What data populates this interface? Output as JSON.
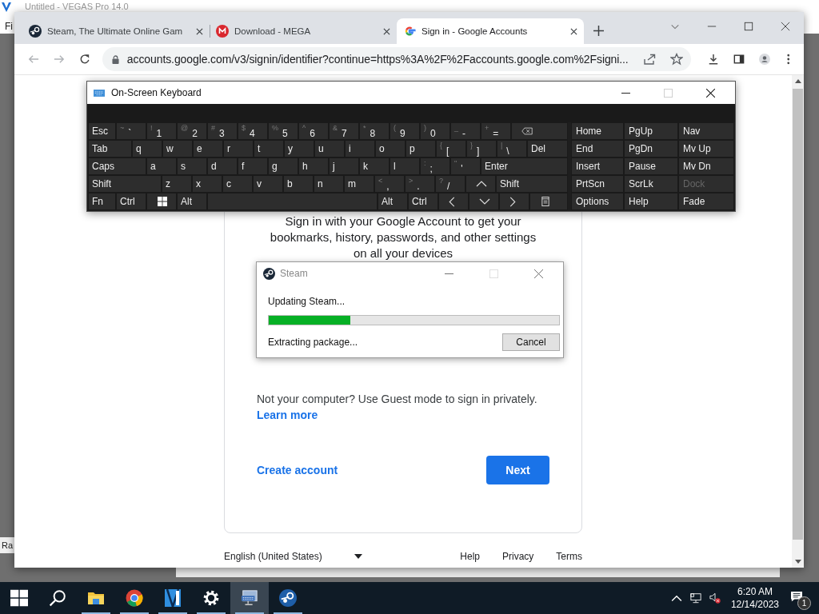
{
  "background_window": {
    "title": "Untitled - VEGAS Pro 14.0",
    "menu_fragment": "Fi",
    "side_fragment": "Ra"
  },
  "browser": {
    "tabs": [
      {
        "title": "Steam, The Ultimate Online Gam",
        "kind": "steam",
        "selected": false
      },
      {
        "title": "Download - MEGA",
        "kind": "mega",
        "selected": false
      },
      {
        "title": "Sign in - Google Accounts",
        "kind": "google",
        "selected": true
      }
    ],
    "url": "accounts.google.com/v3/signin/identifier?continue=https%3A%2F%2Faccounts.google.com%2Fsigni..."
  },
  "page": {
    "intro": "Sign in with your Google Account to get your bookmarks, history, passwords, and other settings on all your devices",
    "guest_note": "Not your computer? Use Guest mode to sign in privately.",
    "learn_more": "Learn more",
    "create_account": "Create account",
    "next": "Next",
    "language": "English (United States)",
    "footer_links": [
      "Help",
      "Privacy",
      "Terms"
    ]
  },
  "keyboard": {
    "title": "On-Screen Keyboard",
    "rows": [
      {
        "keys": [
          {
            "kind": "label",
            "label": "Esc"
          },
          {
            "kind": "dual",
            "shift": "~",
            "main": "`"
          },
          {
            "kind": "dual",
            "shift": "!",
            "main": "1"
          },
          {
            "kind": "dual",
            "shift": "@",
            "main": "2"
          },
          {
            "kind": "dual",
            "shift": "#",
            "main": "3"
          },
          {
            "kind": "dual",
            "shift": "$",
            "main": "4"
          },
          {
            "kind": "dual",
            "shift": "%",
            "main": "5"
          },
          {
            "kind": "dual",
            "shift": "^",
            "main": "6"
          },
          {
            "kind": "dual",
            "shift": "&",
            "main": "7"
          },
          {
            "kind": "dual",
            "shift": "*",
            "main": "8"
          },
          {
            "kind": "dual",
            "shift": "(",
            "main": "9"
          },
          {
            "kind": "dual",
            "shift": ")",
            "main": "0"
          },
          {
            "kind": "dual",
            "shift": "_",
            "main": "-"
          },
          {
            "kind": "dual",
            "shift": "+",
            "main": "="
          },
          {
            "kind": "backspace"
          }
        ]
      },
      {
        "keys": [
          {
            "kind": "label",
            "label": "Tab"
          },
          {
            "kind": "label",
            "label": "q"
          },
          {
            "kind": "label",
            "label": "w"
          },
          {
            "kind": "label",
            "label": "e"
          },
          {
            "kind": "label",
            "label": "r"
          },
          {
            "kind": "label",
            "label": "t"
          },
          {
            "kind": "label",
            "label": "y"
          },
          {
            "kind": "label",
            "label": "u"
          },
          {
            "kind": "label",
            "label": "i"
          },
          {
            "kind": "label",
            "label": "o"
          },
          {
            "kind": "label",
            "label": "p"
          },
          {
            "kind": "dual",
            "shift": "{",
            "main": "["
          },
          {
            "kind": "dual",
            "shift": "}",
            "main": "]"
          },
          {
            "kind": "dual",
            "shift": "|",
            "main": "\\"
          },
          {
            "kind": "label",
            "label": "Del"
          }
        ]
      },
      {
        "keys": [
          {
            "kind": "label",
            "label": "Caps"
          },
          {
            "kind": "label",
            "label": "a"
          },
          {
            "kind": "label",
            "label": "s"
          },
          {
            "kind": "label",
            "label": "d"
          },
          {
            "kind": "label",
            "label": "f"
          },
          {
            "kind": "label",
            "label": "g"
          },
          {
            "kind": "label",
            "label": "h"
          },
          {
            "kind": "label",
            "label": "j"
          },
          {
            "kind": "label",
            "label": "k"
          },
          {
            "kind": "label",
            "label": "l"
          },
          {
            "kind": "dual",
            "shift": ":",
            "main": ";"
          },
          {
            "kind": "dual",
            "shift": "\"",
            "main": "'"
          },
          {
            "kind": "label",
            "label": "Enter"
          }
        ]
      },
      {
        "keys": [
          {
            "kind": "label",
            "label": "Shift"
          },
          {
            "kind": "label",
            "label": "z"
          },
          {
            "kind": "label",
            "label": "x"
          },
          {
            "kind": "label",
            "label": "c"
          },
          {
            "kind": "label",
            "label": "v"
          },
          {
            "kind": "label",
            "label": "b"
          },
          {
            "kind": "label",
            "label": "n"
          },
          {
            "kind": "label",
            "label": "m"
          },
          {
            "kind": "dual",
            "shift": "<",
            "main": ","
          },
          {
            "kind": "dual",
            "shift": ">",
            "main": "."
          },
          {
            "kind": "dual",
            "shift": "?",
            "main": "/"
          },
          {
            "kind": "up"
          },
          {
            "kind": "label",
            "label": "Shift"
          }
        ]
      },
      {
        "keys": [
          {
            "kind": "label",
            "label": "Fn"
          },
          {
            "kind": "label",
            "label": "Ctrl"
          },
          {
            "kind": "windows"
          },
          {
            "kind": "label",
            "label": "Alt"
          },
          {
            "kind": "space"
          },
          {
            "kind": "label",
            "label": "Alt"
          },
          {
            "kind": "label",
            "label": "Ctrl"
          },
          {
            "kind": "left"
          },
          {
            "kind": "down"
          },
          {
            "kind": "right"
          },
          {
            "kind": "menu"
          }
        ]
      }
    ],
    "nav_rows": [
      [
        {
          "label": "Home",
          "disabled": false
        },
        {
          "label": "PgUp",
          "disabled": false
        },
        {
          "label": "Nav",
          "disabled": false
        }
      ],
      [
        {
          "label": "End",
          "disabled": false
        },
        {
          "label": "PgDn",
          "disabled": false
        },
        {
          "label": "Mv Up",
          "disabled": false
        }
      ],
      [
        {
          "label": "Insert",
          "disabled": false
        },
        {
          "label": "Pause",
          "disabled": false
        },
        {
          "label": "Mv Dn",
          "disabled": false
        }
      ],
      [
        {
          "label": "PrtScn",
          "disabled": false
        },
        {
          "label": "ScrLk",
          "disabled": false
        },
        {
          "label": "Dock",
          "disabled": true
        }
      ],
      [
        {
          "label": "Options",
          "disabled": false
        },
        {
          "label": "Help",
          "disabled": false
        },
        {
          "label": "Fade",
          "disabled": false
        }
      ]
    ]
  },
  "steam_dialog": {
    "title": "Steam",
    "status": "Updating Steam...",
    "progress": {
      "level": 0.28
    },
    "detail": "Extracting package...",
    "cancel": "Cancel"
  },
  "taskbar": {
    "apps": [
      {
        "kind": "explorer",
        "running": true,
        "selected": false
      },
      {
        "kind": "chrome",
        "running": true,
        "selected": false
      },
      {
        "kind": "vegas",
        "running": true,
        "selected": false
      },
      {
        "kind": "settings",
        "running": true,
        "selected": false
      },
      {
        "kind": "keyboard",
        "running": true,
        "selected": true
      },
      {
        "kind": "steam",
        "running": true,
        "selected": false
      }
    ],
    "time": "6:20 AM",
    "date": "12/14/2023",
    "notifications": "1"
  }
}
